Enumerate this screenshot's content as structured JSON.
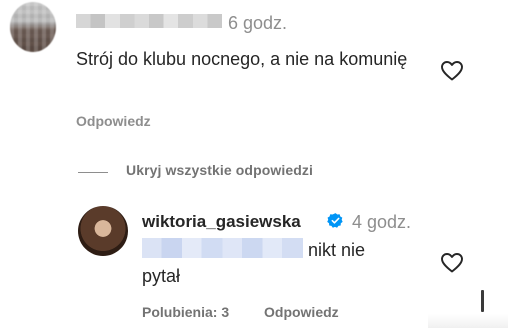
{
  "comment_1": {
    "time": "6 godz.",
    "text": "Strój do klubu nocnego, a nie na komunię",
    "reply_label": "Odpowiedz"
  },
  "thread": {
    "toggle_label": "Ukryj wszystkie odpowiedzi"
  },
  "reply_1": {
    "username": "wiktoria_gasiewska",
    "time": "4 godz.",
    "text_part_1": "nikt nie",
    "text_part_2": "pytał",
    "likes_label": "Polubienia: 3",
    "reply_label": "Odpowiedz"
  },
  "icons": {
    "like": "heart-outline-icon",
    "verified": "verified-badge-icon"
  },
  "colors": {
    "primary_text": "#262626",
    "secondary_text": "#8e8e8e",
    "verified_blue": "#0095f6"
  }
}
